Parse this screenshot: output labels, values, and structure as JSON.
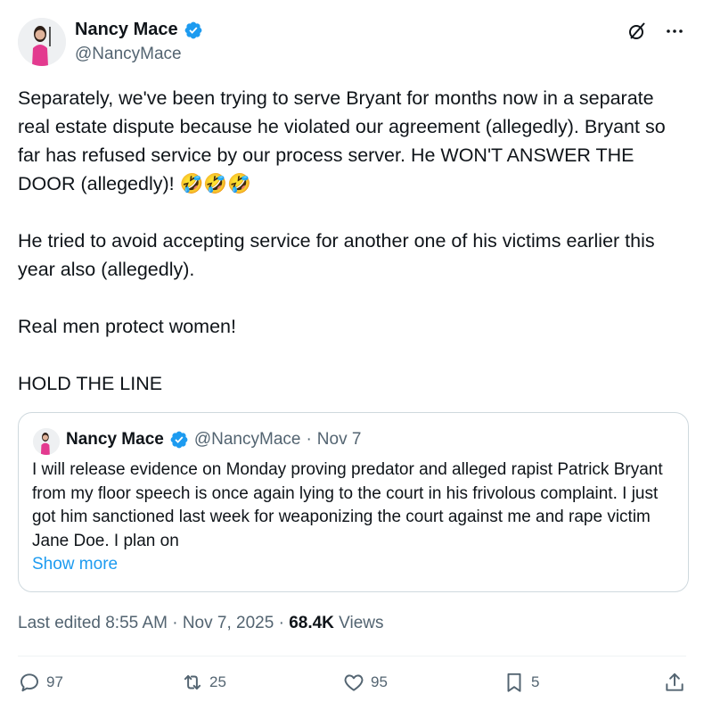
{
  "author": {
    "name": "Nancy Mace",
    "handle": "@NancyMace"
  },
  "tweet": {
    "paragraphs": [
      "Separately, we've been trying to serve Bryant for months now in a separate real estate dispute because he  violated our agreement (allegedly). Bryant  so far has refused service by our process server. He WON'T ANSWER THE DOOR (allegedly)! 🤣🤣🤣",
      "He tried to avoid accepting service for another one of his victims earlier this year also (allegedly).",
      "Real men protect women!",
      "HOLD THE LINE"
    ]
  },
  "quote": {
    "name": "Nancy Mace",
    "handle": "@NancyMace",
    "sep": "·",
    "date": "Nov 7",
    "text": "I will release evidence on Monday proving predator and alleged rapist Patrick Bryant from my floor speech is once again lying to the court in his frivolous complaint. I just got him sanctioned last week for weaponizing the court against me and rape victim Jane Doe. I plan on",
    "show_more": "Show more"
  },
  "meta": {
    "edited": "Last edited 8:55 AM · Nov 7, 2025 ·",
    "views_count": "68.4K",
    "views_label": "Views"
  },
  "actions": {
    "replies": "97",
    "reposts": "25",
    "likes": "95",
    "bookmarks": "5"
  },
  "colors": {
    "accent": "#1d9bf0",
    "text": "#0f1419",
    "secondary": "#536471",
    "border": "#cfd9de"
  },
  "icons": [
    "verified-badge-icon",
    "grok-icon",
    "more-icon",
    "reply-icon",
    "repost-icon",
    "like-icon",
    "bookmark-icon",
    "share-icon"
  ]
}
